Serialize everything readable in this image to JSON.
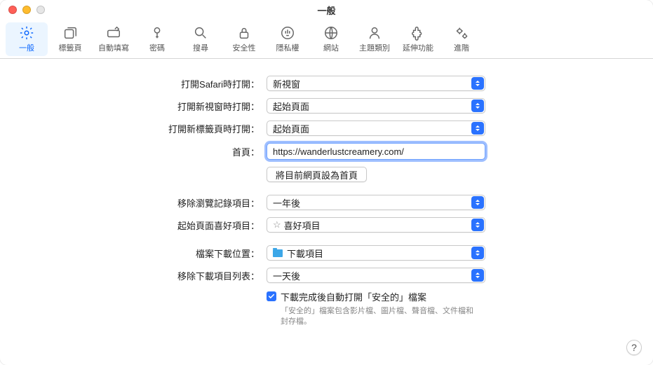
{
  "window": {
    "title": "一般"
  },
  "toolbar": {
    "items": [
      {
        "id": "general",
        "label": "一般",
        "active": true
      },
      {
        "id": "tabs",
        "label": "標籤頁"
      },
      {
        "id": "autofill",
        "label": "自動填寫"
      },
      {
        "id": "passwords",
        "label": "密碼"
      },
      {
        "id": "search",
        "label": "搜尋"
      },
      {
        "id": "security",
        "label": "安全性"
      },
      {
        "id": "privacy",
        "label": "隱私權"
      },
      {
        "id": "websites",
        "label": "網站"
      },
      {
        "id": "themes",
        "label": "主題類別"
      },
      {
        "id": "extensions",
        "label": "延伸功能"
      },
      {
        "id": "advanced",
        "label": "進階"
      }
    ]
  },
  "labels": {
    "open_safari": "打開Safari時打開：",
    "open_window": "打開新視窗時打開：",
    "open_tab": "打開新標籤頁時打開：",
    "homepage": "首頁：",
    "set_current": "將目前網頁設為首頁",
    "remove_history": "移除瀏覽記錄項目：",
    "favorites": "起始頁面喜好項目：",
    "download_loc": "檔案下載位置：",
    "remove_downloads": "移除下載項目列表：",
    "safe_open": "下載完成後自動打開「安全的」檔案",
    "safe_help": "「安全的」檔案包含影片檔、圖片檔、聲音檔、文件檔和封存檔。"
  },
  "values": {
    "open_safari": "新視窗",
    "open_window": "起始頁面",
    "open_tab": "起始頁面",
    "homepage": "https://wanderlustcreamery.com/",
    "remove_history": "一年後",
    "favorites": "喜好項目",
    "download_loc": "下載項目",
    "remove_downloads": "一天後"
  },
  "help": "?"
}
